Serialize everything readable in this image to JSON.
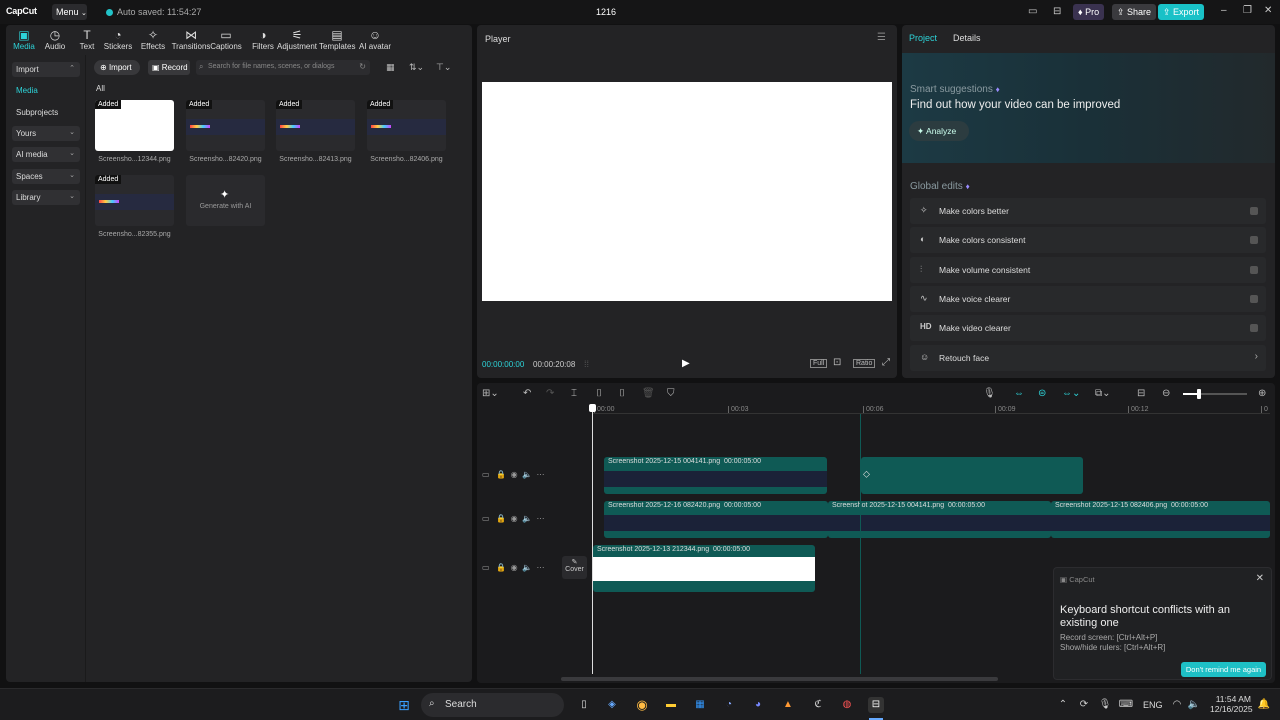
{
  "app": {
    "logo": "CapCut",
    "menu_label": "Menu",
    "autosave": "Auto saved: 11:54:27",
    "project_title": "1216",
    "pro_label": "Pro",
    "share_label": "Share",
    "export_label": "Export"
  },
  "toolbar_tabs": [
    {
      "label": "Media",
      "icon": "media-icon"
    },
    {
      "label": "Audio",
      "icon": "audio-icon"
    },
    {
      "label": "Text",
      "icon": "text-icon"
    },
    {
      "label": "Stickers",
      "icon": "stickers-icon"
    },
    {
      "label": "Effects",
      "icon": "effects-icon"
    },
    {
      "label": "Transitions",
      "icon": "transitions-icon"
    },
    {
      "label": "Captions",
      "icon": "captions-icon"
    },
    {
      "label": "Filters",
      "icon": "filters-icon"
    },
    {
      "label": "Adjustment",
      "icon": "adjustment-icon"
    },
    {
      "label": "Templates",
      "icon": "templates-icon"
    },
    {
      "label": "AI avatar",
      "icon": "ai-avatar-icon"
    }
  ],
  "sidebar": {
    "items": [
      {
        "label": "Import"
      },
      {
        "label": "Media"
      },
      {
        "label": "Subprojects"
      },
      {
        "label": "Yours"
      },
      {
        "label": "AI media"
      },
      {
        "label": "Spaces"
      },
      {
        "label": "Library"
      }
    ]
  },
  "media": {
    "import_label": "Import",
    "record_label": "Record",
    "search_placeholder": "Search for file names, scenes, or dialogs",
    "filter_all": "All",
    "items": [
      {
        "caption": "Screensho...12344.png",
        "badge": "Added"
      },
      {
        "caption": "Screensho...82420.png",
        "badge": "Added"
      },
      {
        "caption": "Screensho...82413.png",
        "badge": "Added"
      },
      {
        "caption": "Screensho...82406.png",
        "badge": "Added"
      },
      {
        "caption": "Screensho...82355.png",
        "badge": "Added"
      }
    ],
    "generate_label": "Generate with AI"
  },
  "player": {
    "title": "Player",
    "current_time": "00:00:00:00",
    "duration": "00:00:20:08",
    "full_label": "Full",
    "ratio_label": "Ratio"
  },
  "right": {
    "tab_project": "Project",
    "tab_details": "Details",
    "smart_title": "Smart suggestions",
    "smart_headline": "Find out how your video can be improved",
    "analyze_label": "Analyze",
    "global_title": "Global edits",
    "global_items": [
      {
        "label": "Make colors better",
        "icon": "wand-icon"
      },
      {
        "label": "Make colors consistent",
        "icon": "palette-icon"
      },
      {
        "label": "Make volume consistent",
        "icon": "sliders-icon"
      },
      {
        "label": "Make voice clearer",
        "icon": "waveform-icon"
      },
      {
        "label": "Make video clearer",
        "icon": "hd-icon",
        "badge": "HD"
      },
      {
        "label": "Retouch face",
        "icon": "face-icon"
      }
    ]
  },
  "timeline": {
    "ruler": [
      "00:00",
      "00:03",
      "00:06",
      "00:09",
      "00:12",
      "0"
    ],
    "clips": [
      {
        "name": "Screenshot 2025-12-15 004141.png",
        "duration": "00:00:05:00"
      },
      {
        "name": "Screenshot 2025-12-16 082420.png",
        "duration": "00:00:05:00"
      },
      {
        "name": "Screenshot 2025-12-15 004141.png",
        "duration": "00:00:05:00"
      },
      {
        "name": "Screenshot 2025-12-15 082406.png",
        "duration": "00:00:05:00"
      },
      {
        "name": "Screenshot 2025-12-13 212344.png",
        "duration": "00:00:05:00"
      }
    ],
    "cover_label": "Cover"
  },
  "notification": {
    "app": "CapCut",
    "title": "Keyboard shortcut conflicts with an existing one",
    "line1": "Record screen: [Ctrl+Alt+P]",
    "line2": "Show/hide rulers: [Ctrl+Alt+R]",
    "button": "Don't remind me again"
  },
  "taskbar": {
    "search_label": "Search",
    "lang": "ENG",
    "time": "11:54 AM",
    "date": "12/16/2025"
  },
  "colors": {
    "accent": "#2dd3d8",
    "clip": "#0f5a55"
  }
}
